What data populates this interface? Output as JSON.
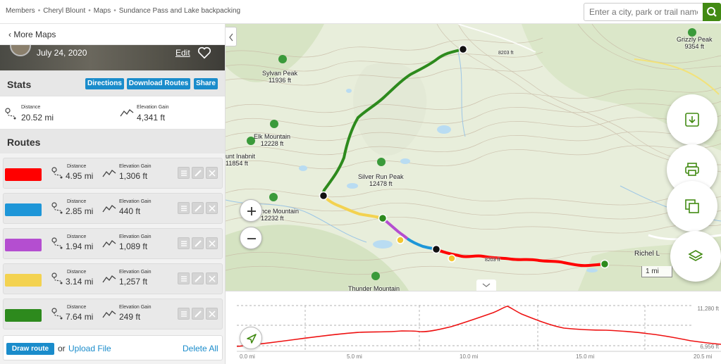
{
  "breadcrumb": [
    "Members",
    "Cheryl Blount",
    "Maps",
    "Sundance Pass and Lake backpacking"
  ],
  "search": {
    "placeholder": "Enter a city, park or trail name"
  },
  "sidebar": {
    "back_label": "More Maps",
    "date": "July 24, 2020",
    "edit_label": "Edit",
    "stats_title": "Stats",
    "buttons": [
      "Directions",
      "Download Routes",
      "Share"
    ],
    "distance_label": "Distance",
    "distance_value": "20.52 mi",
    "gain_label": "Elevation Gain",
    "gain_value": "4,341 ft",
    "routes_title": "Routes",
    "routes": [
      {
        "color": "#ff0000",
        "distance_label": "Distance",
        "distance": "4.95 mi",
        "gain_label": "Elevation Gain",
        "gain": "1,306 ft"
      },
      {
        "color": "#1e96d8",
        "distance_label": "Distance",
        "distance": "2.85 mi",
        "gain_label": "Elevation Gain",
        "gain": "440 ft"
      },
      {
        "color": "#b44ed0",
        "distance_label": "Distance",
        "distance": "1.94 mi",
        "gain_label": "Elevation Gain",
        "gain": "1,089 ft"
      },
      {
        "color": "#f3d250",
        "distance_label": "Distance",
        "distance": "3.14 mi",
        "gain_label": "Elevation Gain",
        "gain": "1,257 ft"
      },
      {
        "color": "#2d8a1d",
        "distance_label": "Distance",
        "distance": "7.64 mi",
        "gain_label": "Elevation Gain",
        "gain": "249 ft"
      }
    ],
    "draw_route": "Draw route",
    "or": "or",
    "upload_file": "Upload File",
    "delete_all": "Delete All"
  },
  "map": {
    "labels": [
      {
        "name": "Sylvan Peak",
        "elev": "11936 ft"
      },
      {
        "name": "Elk Mountain",
        "elev": "12228 ft"
      },
      {
        "name": "unt Inabnit",
        "elev": "11854 ft"
      },
      {
        "name": "Silver Run Peak",
        "elev": "12478 ft"
      },
      {
        "name": "nce Mountain",
        "elev": "12232 ft"
      },
      {
        "name": "Grizzly Peak",
        "elev": "9354 ft"
      },
      {
        "name": "Thunder Mountain",
        "elev": ""
      },
      {
        "name": "Richel L",
        "elev": ""
      }
    ],
    "contour_labels": [
      "8203 ft",
      "8203 ft"
    ],
    "scale": "1 mi"
  },
  "elevation": {
    "max_label": "11,280 ft",
    "min_label": "6,956 ft",
    "x_ticks": [
      "0.0 mi",
      "5.0 mi",
      "10.0 mi",
      "15.0 mi",
      "20.5 mi"
    ]
  },
  "colors": {
    "accent_green": "#428a13",
    "button_blue": "#1a8ccb",
    "route_red": "#ff0000"
  }
}
